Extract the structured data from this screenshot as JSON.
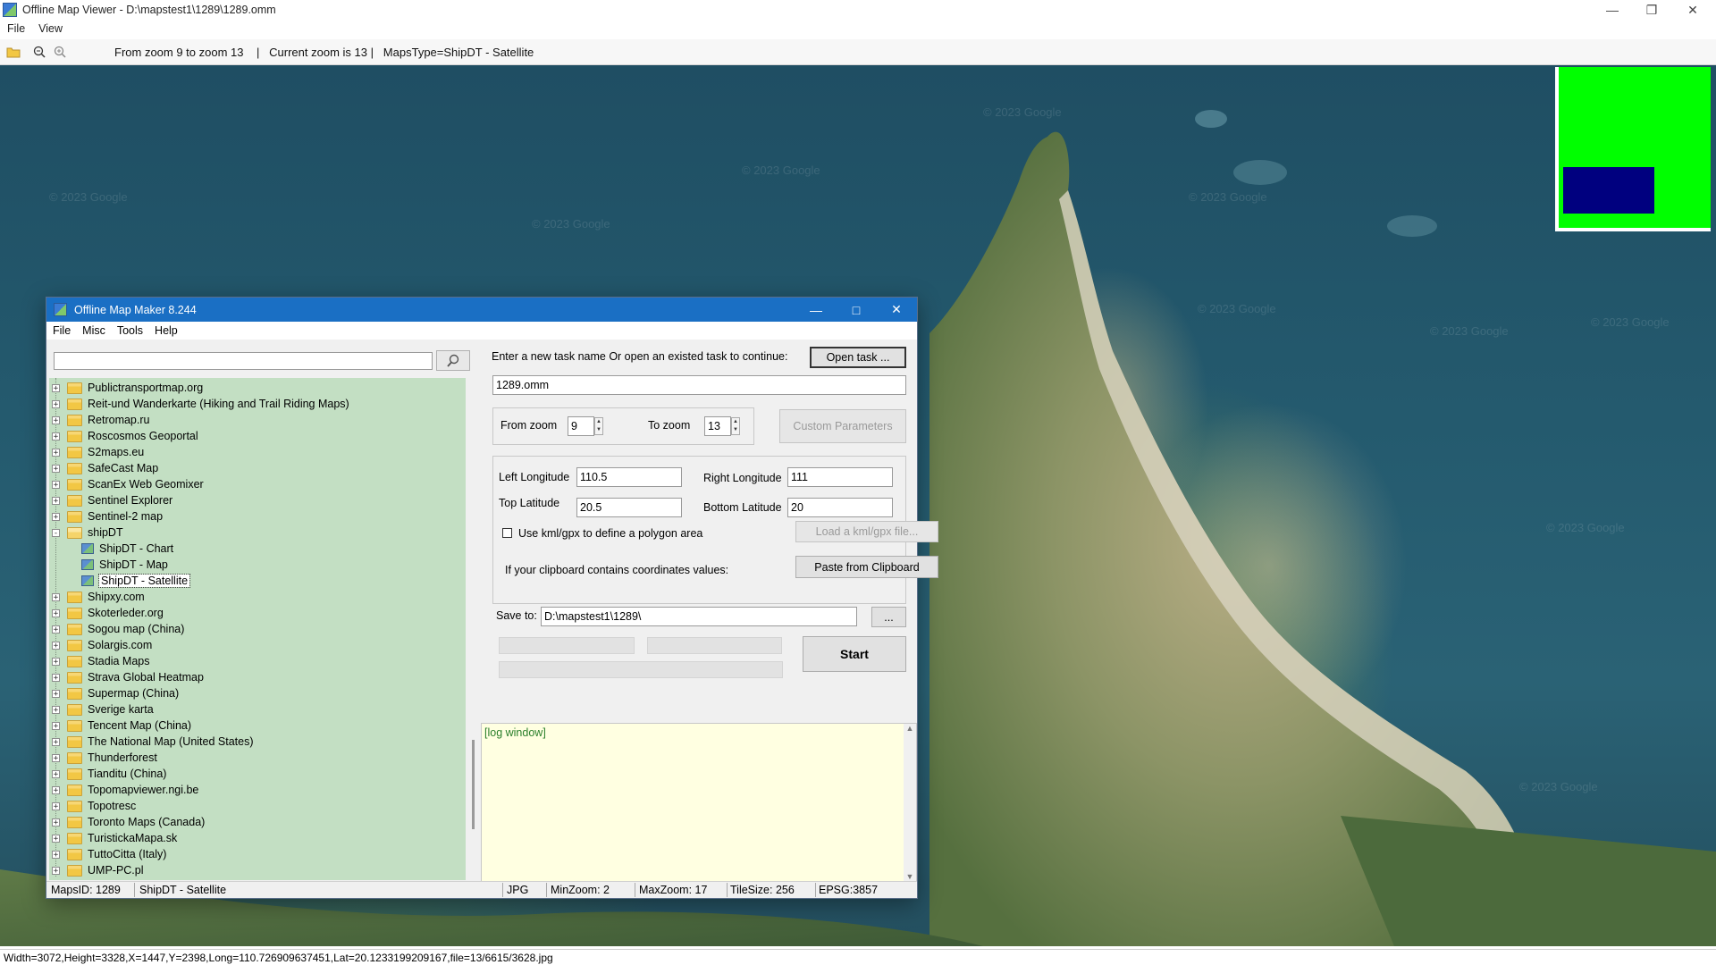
{
  "viewer": {
    "title": "Offline Map Viewer - D:\\mapstest1\\1289\\1289.omm",
    "menu": [
      "File",
      "View"
    ],
    "toolbar_info": "From zoom 9 to zoom 13    |   Current zoom is 13 |   MapsType=ShipDT - Satellite",
    "watermark": "© 2023 Google",
    "status": "Width=3072,Height=3328,X=1447,Y=2398,Long=110.726909637451,Lat=20.1233199209167,file=13/6615/3628.jpg"
  },
  "dialog": {
    "title": "Offline Map Maker 8.244",
    "menu": [
      "File",
      "Misc",
      "Tools",
      "Help"
    ],
    "search_value": "",
    "tree": [
      {
        "label": "Publictransportmap.org",
        "type": "folder"
      },
      {
        "label": "Reit-und Wanderkarte (Hiking and Trail Riding Maps)",
        "type": "folder"
      },
      {
        "label": "Retromap.ru",
        "type": "folder"
      },
      {
        "label": "Roscosmos Geoportal",
        "type": "folder"
      },
      {
        "label": "S2maps.eu",
        "type": "folder"
      },
      {
        "label": "SafeCast Map",
        "type": "folder"
      },
      {
        "label": "ScanEx Web Geomixer",
        "type": "folder"
      },
      {
        "label": "Sentinel Explorer",
        "type": "folder"
      },
      {
        "label": "Sentinel-2 map",
        "type": "folder"
      },
      {
        "label": "shipDT",
        "type": "folder-open"
      },
      {
        "label": "ShipDT - Chart",
        "type": "map"
      },
      {
        "label": "ShipDT - Map",
        "type": "map"
      },
      {
        "label": "ShipDT - Satellite",
        "type": "map-selected"
      },
      {
        "label": "Shipxy.com",
        "type": "folder"
      },
      {
        "label": "Skoterleder.org",
        "type": "folder"
      },
      {
        "label": "Sogou map (China)",
        "type": "folder"
      },
      {
        "label": "Solargis.com",
        "type": "folder"
      },
      {
        "label": "Stadia Maps",
        "type": "folder"
      },
      {
        "label": "Strava Global Heatmap",
        "type": "folder"
      },
      {
        "label": "Supermap (China)",
        "type": "folder"
      },
      {
        "label": "Sverige karta",
        "type": "folder"
      },
      {
        "label": "Tencent Map (China)",
        "type": "folder"
      },
      {
        "label": "The National Map (United States)",
        "type": "folder"
      },
      {
        "label": "Thunderforest",
        "type": "folder"
      },
      {
        "label": "Tianditu (China)",
        "type": "folder"
      },
      {
        "label": "Topomapviewer.ngi.be",
        "type": "folder"
      },
      {
        "label": "Topotresc",
        "type": "folder"
      },
      {
        "label": "Toronto Maps (Canada)",
        "type": "folder"
      },
      {
        "label": "TuristickaMapa.sk",
        "type": "folder"
      },
      {
        "label": "TuttoCitta (Italy)",
        "type": "folder"
      },
      {
        "label": "UMP-PC.pl",
        "type": "folder"
      }
    ],
    "task_prompt": "Enter a new task name Or open an existed task to continue:",
    "open_task": "Open task ...",
    "task_name": "1289.omm",
    "from_zoom_label": "From zoom",
    "from_zoom": "9",
    "to_zoom_label": "To zoom",
    "to_zoom": "13",
    "custom_params": "Custom Parameters",
    "left_lon_label": "Left Longitude",
    "left_lon": "110.5",
    "right_lon_label": "Right Longitude",
    "right_lon": "111",
    "top_lat_label": "Top Latitude",
    "top_lat": "20.5",
    "bottom_lat_label": "Bottom Latitude",
    "bottom_lat": "20",
    "kml_label": "Use kml/gpx to define a polygon area",
    "kml_checked": false,
    "load_kml": "Load a kml/gpx file...",
    "clipboard_label": "If your clipboard contains coordinates values:",
    "paste_clipboard": "Paste from Clipboard",
    "save_to_label": "Save to:",
    "save_to": "D:\\mapstest1\\1289\\",
    "browse": "...",
    "start": "Start",
    "log": "[log window]",
    "status": {
      "maps_id": "MapsID: 1289",
      "maps_name": "ShipDT - Satellite",
      "format": "JPG",
      "min_zoom": "MinZoom: 2",
      "max_zoom": "MaxZoom: 17",
      "tile_size": "TileSize: 256",
      "epsg": "EPSG:3857"
    }
  },
  "colors": {
    "dialog_title": "#1a6fc4",
    "tree_bg": "#c3dfc3",
    "log_bg": "#ffffe1",
    "minimap": "#00ff00",
    "minimap_view": "#00007f"
  }
}
